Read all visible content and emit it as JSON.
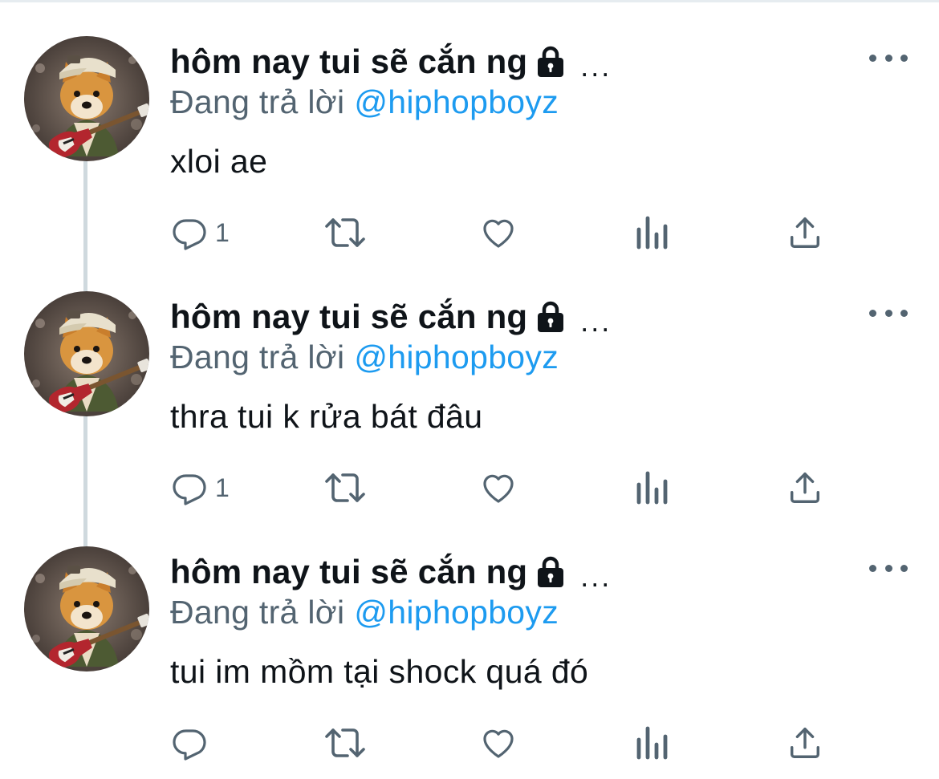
{
  "colors": {
    "text_primary": "#0f1419",
    "text_secondary": "#536471",
    "accent": "#1d9bf0",
    "thread_line": "#cfd9de",
    "divider": "#e6ecf0"
  },
  "tweets": [
    {
      "display_name": "hôm nay tui sẽ cắn ng",
      "protected_icon": "lock-icon",
      "truncation": "...",
      "reply_label": "Đang trả lời",
      "reply_handle": "@hiphopboyz",
      "text": "xloi ae",
      "reply_count": "1",
      "more_icon": "more-options-icon"
    },
    {
      "display_name": "hôm nay tui sẽ cắn ng",
      "protected_icon": "lock-icon",
      "truncation": "...",
      "reply_label": "Đang trả lời",
      "reply_handle": "@hiphopboyz",
      "text": "thra tui k rửa bát đâu",
      "reply_count": "1",
      "more_icon": "more-options-icon"
    },
    {
      "display_name": "hôm nay tui sẽ cắn ng",
      "protected_icon": "lock-icon",
      "truncation": "...",
      "reply_label": "Đang trả lời",
      "reply_handle": "@hiphopboyz",
      "text": "tui im mồm tại shock quá đó",
      "reply_count": "",
      "more_icon": "more-options-icon"
    }
  ],
  "action_icons": [
    "reply-icon",
    "retweet-icon",
    "like-icon",
    "analytics-icon",
    "share-icon"
  ]
}
